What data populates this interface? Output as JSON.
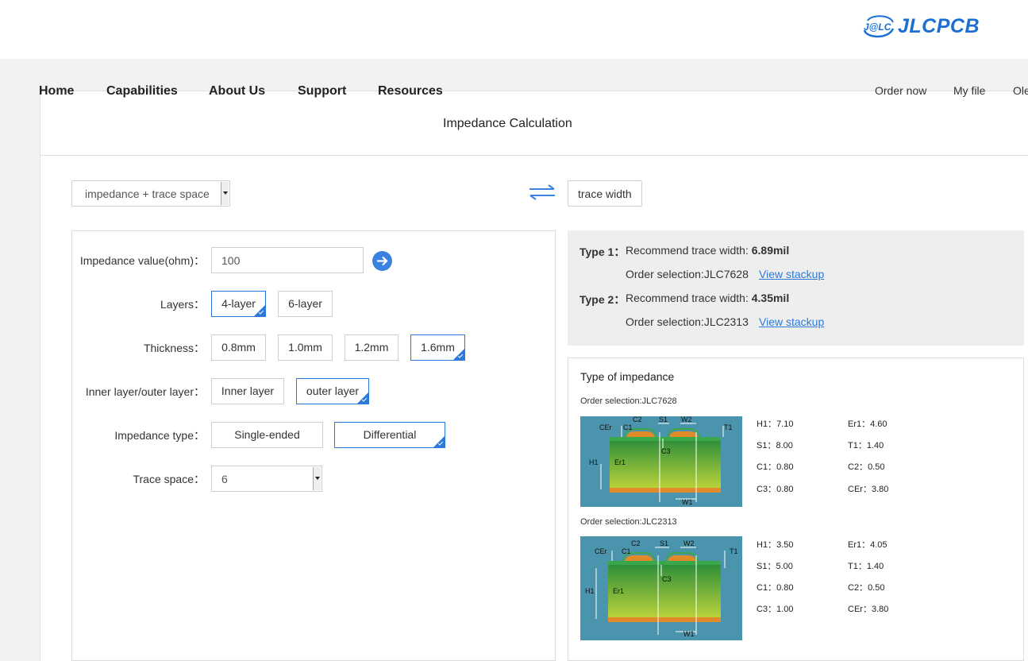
{
  "header": {
    "logo_badge": "J@LC",
    "logo_text": "JLCPCB"
  },
  "nav": {
    "items": [
      "Home",
      "Capabilities",
      "About Us",
      "Support",
      "Resources"
    ],
    "right_items": [
      "Order now",
      "My file",
      "Ole"
    ]
  },
  "page_title": "Impedance Calculation",
  "mode_select": {
    "value": "impedance + trace space"
  },
  "trace_width_button": "trace width",
  "form": {
    "impedance_label": "Impedance value(ohm)：",
    "impedance_value": "100",
    "layers_label": "Layers：",
    "layers_options": [
      "4-layer",
      "6-layer"
    ],
    "layers_selected": "4-layer",
    "thickness_label": "Thickness：",
    "thickness_options": [
      "0.8mm",
      "1.0mm",
      "1.2mm",
      "1.6mm"
    ],
    "thickness_selected": "1.6mm",
    "layer_type_label": "Inner layer/outer layer：",
    "layer_type_options": [
      "Inner layer",
      "outer layer"
    ],
    "layer_type_selected": "outer layer",
    "impedance_type_label": "Impedance type：",
    "impedance_type_options": [
      "Single-ended",
      "Differential"
    ],
    "impedance_type_selected": "Differential",
    "trace_space_label": "Trace space：",
    "trace_space_value": "6"
  },
  "results": [
    {
      "type": "Type 1：",
      "text": "Recommend trace width: ",
      "value": "6.89mil",
      "order": "Order selection:JLC7628",
      "link": "View stackup"
    },
    {
      "type": "Type 2：",
      "text": "Recommend trace width: ",
      "value": "4.35mil",
      "order": "Order selection:JLC2313",
      "link": "View stackup"
    }
  ],
  "type_of_impedance": {
    "title": "Type of impedance",
    "stackups": [
      {
        "order": "Order selection:JLC7628",
        "params": [
          [
            "H1：",
            "7.10",
            "Er1：",
            "4.60"
          ],
          [
            "S1：",
            "8.00",
            "T1：",
            "1.40"
          ],
          [
            "C1：",
            "0.80",
            "C2：",
            "0.50"
          ],
          [
            "C3：",
            "0.80",
            "CEr：",
            "3.80"
          ]
        ]
      },
      {
        "order": "Order selection:JLC2313",
        "params": [
          [
            "H1：",
            "3.50",
            "Er1：",
            "4.05"
          ],
          [
            "S1：",
            "5.00",
            "T1：",
            "1.40"
          ],
          [
            "C1：",
            "0.80",
            "C2：",
            "0.50"
          ],
          [
            "C3：",
            "1.00",
            "CEr：",
            "3.80"
          ]
        ]
      }
    ],
    "diagram_labels": [
      "CEr",
      "C1",
      "C2",
      "S1",
      "W2",
      "T1",
      "H1",
      "Er1",
      "C3",
      "W1"
    ]
  }
}
